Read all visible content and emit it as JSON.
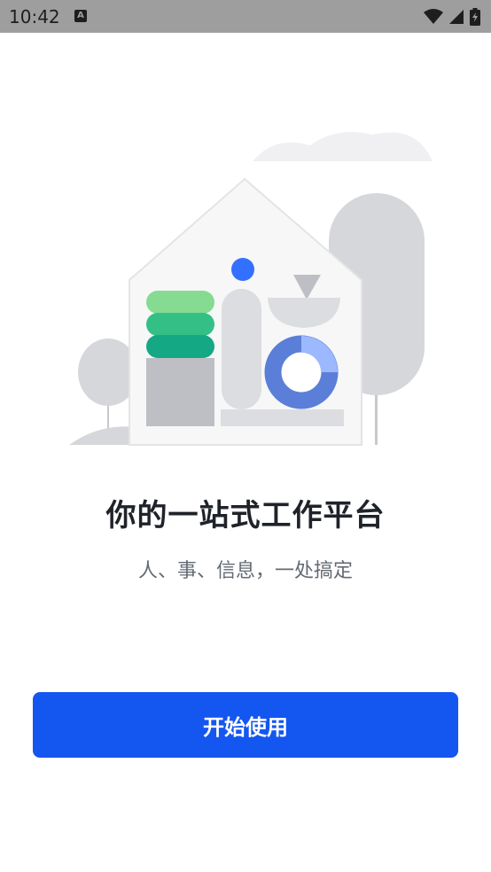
{
  "status_bar": {
    "time": "10:42",
    "notification_icon": "a-notification-icon",
    "wifi_icon": "wifi-icon",
    "signal_icon": "cellular-signal-icon",
    "battery_icon": "battery-charging-icon"
  },
  "illustration": {
    "name": "house-workplace-illustration"
  },
  "onboarding": {
    "title": "你的一站式工作平台",
    "subtitle": "人、事、信息，一处搞定"
  },
  "actions": {
    "start_label": "开始使用"
  },
  "colors": {
    "primary": "#1456f0",
    "title": "#1f2329",
    "subtitle": "#646a73",
    "status_bar": "#9e9e9e"
  }
}
